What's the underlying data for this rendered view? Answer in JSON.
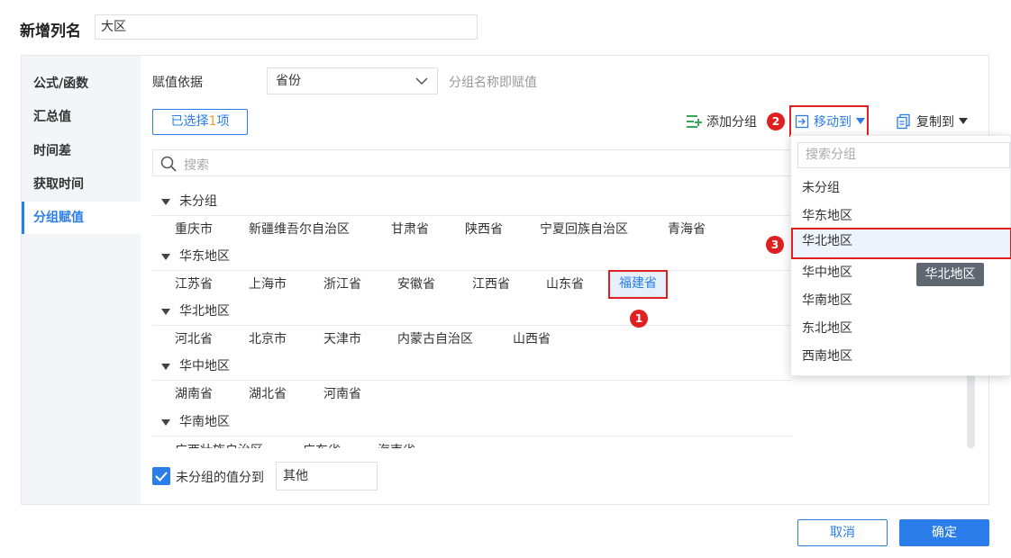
{
  "header": {
    "title": "新增列名",
    "column_name_value": "大区"
  },
  "sidebar": {
    "items": [
      {
        "label": "公式/函数"
      },
      {
        "label": "汇总值"
      },
      {
        "label": "时间差"
      },
      {
        "label": "获取时间"
      },
      {
        "label": "分组赋值",
        "active": true
      }
    ]
  },
  "form": {
    "basis_label": "赋值依据",
    "basis_value": "省份",
    "basis_hint": "分组名称即赋值",
    "selected_prefix": "已选择",
    "selected_count": "1",
    "selected_suffix": "项",
    "search_placeholder": "搜索"
  },
  "toolbar": {
    "add_group": "添加分组",
    "move_to": "移动到",
    "copy_to": "复制到",
    "badge_move": "2"
  },
  "groups": [
    {
      "name": "未分组",
      "items": [
        "重庆市",
        "新疆维吾尔自治区",
        "甘肃省",
        "陕西省",
        "宁夏回族自治区",
        "青海省"
      ]
    },
    {
      "name": "华东地区",
      "items": [
        "江苏省",
        "上海市",
        "浙江省",
        "安徽省",
        "江西省",
        "山东省",
        "福建省"
      ],
      "selected": "福建省"
    },
    {
      "name": "华北地区",
      "items": [
        "河北省",
        "北京市",
        "天津市",
        "内蒙古自治区",
        "山西省"
      ]
    },
    {
      "name": "华中地区",
      "items": [
        "湖南省",
        "湖北省",
        "河南省"
      ]
    },
    {
      "name": "华南地区",
      "items": [
        "广西壮族自治区",
        "广东省",
        "海南省"
      ]
    }
  ],
  "annotations": {
    "badge_selected": "1",
    "badge_target": "3"
  },
  "dropdown": {
    "search_placeholder": "搜索分组",
    "items": [
      "未分组",
      "华东地区",
      "华北地区",
      "华中地区",
      "华南地区",
      "东北地区",
      "西南地区"
    ],
    "highlighted": "华北地区",
    "tooltip": "华北地区"
  },
  "footer": {
    "checkbox_label": "未分组的值分到",
    "other_value": "其他",
    "cancel": "取消",
    "confirm": "确定"
  },
  "colors": {
    "accent": "#2b7de9",
    "annotation_red": "#e02020",
    "count_orange": "#f59a23"
  }
}
